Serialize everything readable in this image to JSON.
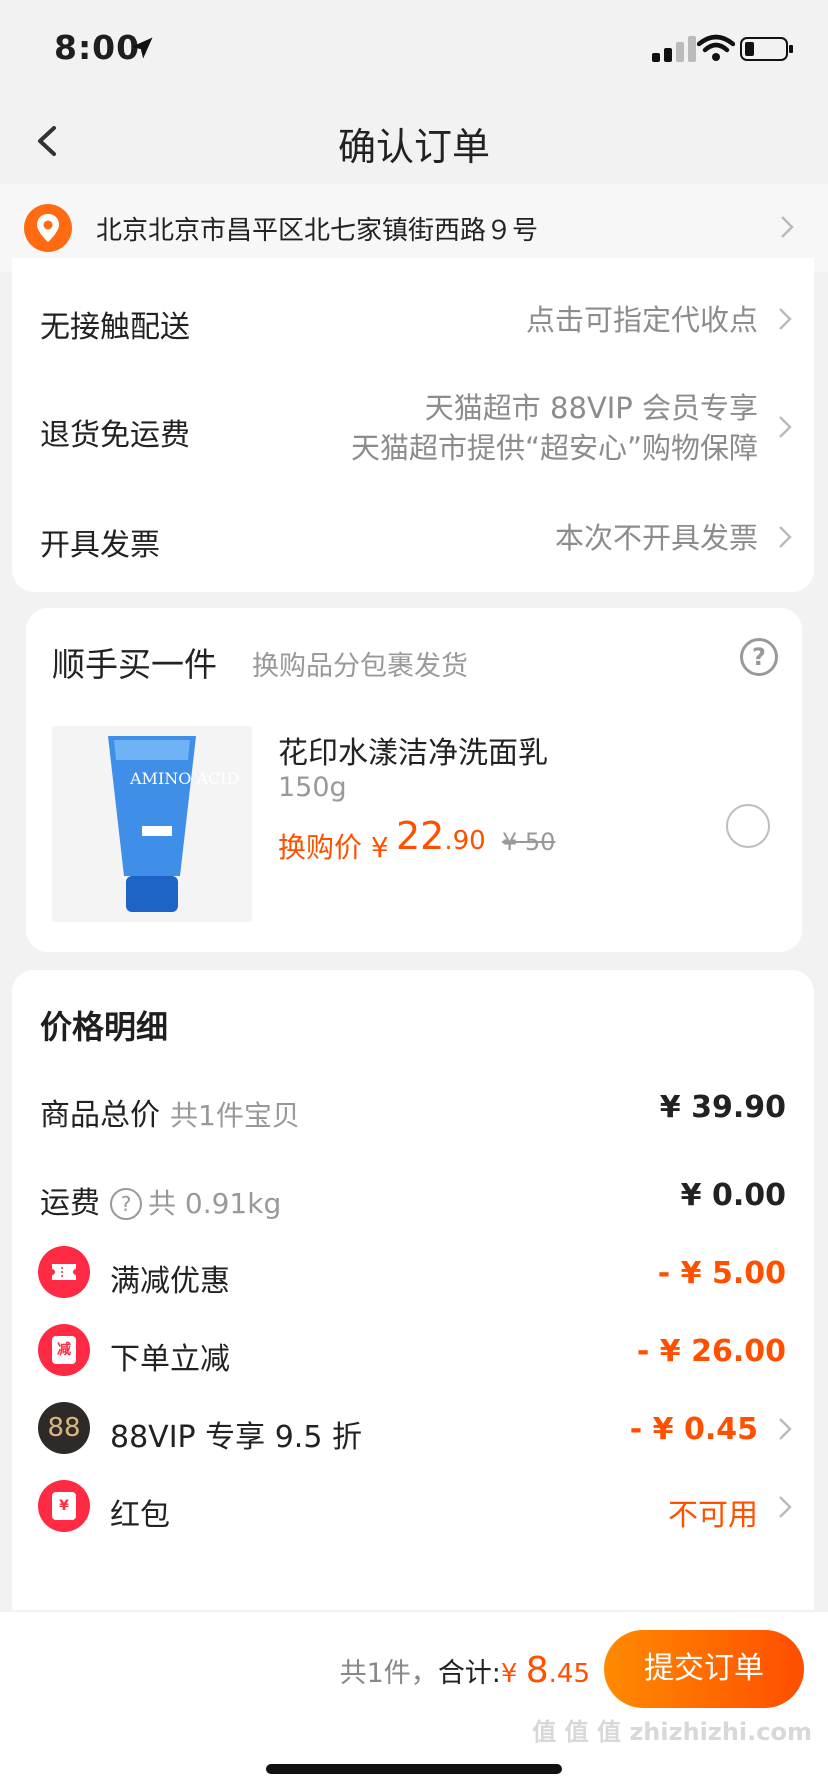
{
  "status_bar": {
    "time": "8:00"
  },
  "nav": {
    "title": "确认订单"
  },
  "address": {
    "text": "北京北京市昌平区北七家镇街西路９号"
  },
  "delivery": {
    "contactless": {
      "label": "无接触配送",
      "value": "点击可指定代收点"
    },
    "return_free": {
      "label": "退货免运费",
      "value_line1": "天猫超市 88VIP 会员专享",
      "value_line2": "天猫超市提供“超安心”购物保障"
    },
    "invoice": {
      "label": "开具发票",
      "value": "本次不开具发票"
    }
  },
  "addon": {
    "title": "顺手买一件",
    "subtitle": "换购品分包裹发货",
    "help_glyph": "?",
    "product": {
      "image_text": "AMINO ACID",
      "name": "花印水漾洁净洗面乳",
      "spec": "150g",
      "price_label": "换购价 ¥",
      "price_int": "22",
      "price_dec": ".90",
      "original_price": "¥ 50"
    }
  },
  "price_detail": {
    "title": "价格明细",
    "goods_total": {
      "label": "商品总价",
      "sub": "共1件宝贝",
      "value": "¥ 39.90"
    },
    "shipping": {
      "label": "运费",
      "help_glyph": "?",
      "sub": "共 0.91kg",
      "value": "¥ 0.00"
    },
    "full_reduction": {
      "label": "满减优惠",
      "value": "- ¥ 5.00"
    },
    "order_reduction": {
      "label": "下单立减",
      "badge_char": "减",
      "value": "- ¥ 26.00"
    },
    "vip": {
      "label": "88VIP 专享 9.5 折",
      "badge_text": "88",
      "value": "- ¥ 0.45"
    },
    "red_packet": {
      "label": "红包",
      "badge_char": "¥",
      "value": "不可用"
    }
  },
  "footer": {
    "count": "共1件，",
    "total_label": "合计:",
    "currency": "¥ ",
    "amount_int": "8",
    "amount_dec": ".45",
    "submit_label": "提交订单",
    "watermark": "值 值 值 zhizhizhi.com"
  },
  "colors": {
    "accent": "#ff5000",
    "badge_red": "#ff2a44",
    "vip_dark": "#2e2a28"
  },
  "icons": [
    "location-arrow-icon",
    "signal-icon",
    "wifi-icon",
    "battery-icon",
    "back-chevron-icon",
    "location-pin-icon",
    "chevron-right-icon",
    "help-circle-icon",
    "radio-unchecked-icon",
    "ticket-icon",
    "reduce-badge-icon",
    "vip-88-icon",
    "red-packet-icon"
  ]
}
